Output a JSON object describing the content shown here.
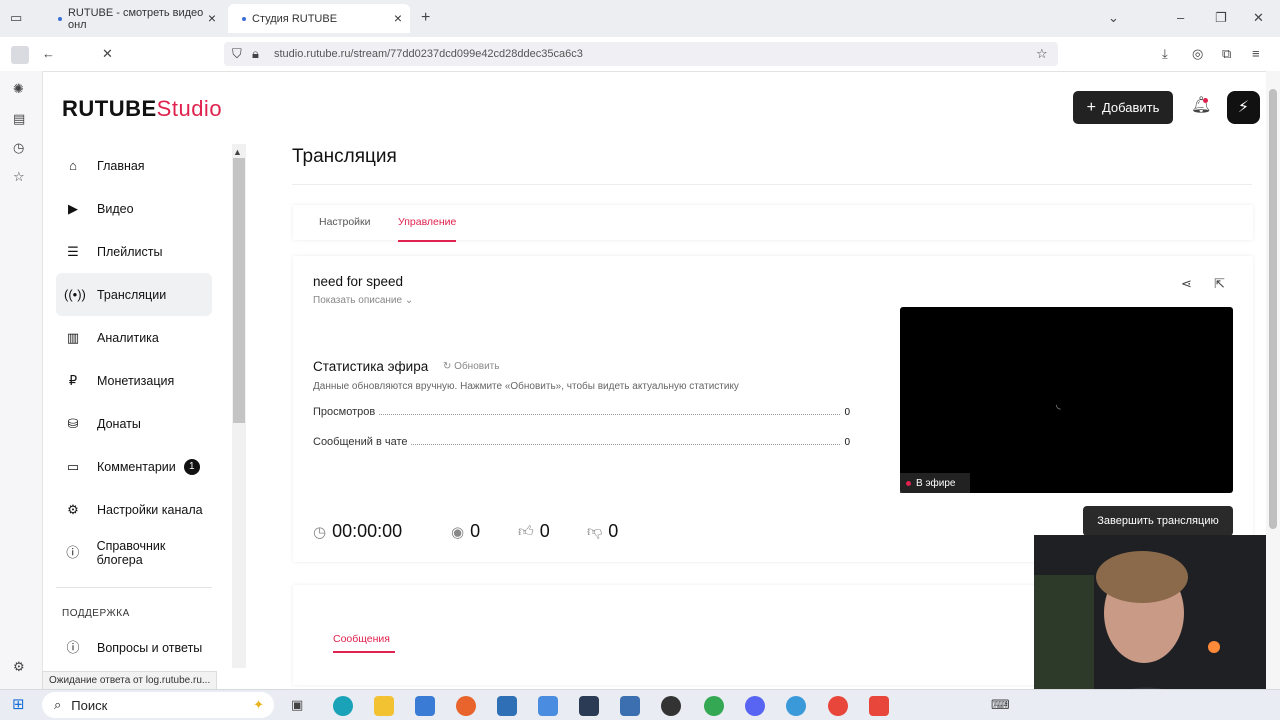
{
  "browser": {
    "tabs": [
      {
        "title": "RUTUBE - смотреть видео онл",
        "active": false
      },
      {
        "title": "Студия RUTUBE",
        "active": true
      }
    ],
    "url": "studio.rutube.ru/stream/77dd0237dcd099e42cd28ddec35ca6c3",
    "status_text": "Ожидание ответа от log.rutube.ru..."
  },
  "header": {
    "logo_main": "RUTUBE",
    "logo_sub": "Studio",
    "add_label": "Добавить"
  },
  "sidebar": {
    "items": [
      {
        "label": "Главная",
        "icon": "home-icon"
      },
      {
        "label": "Видео",
        "icon": "video-icon"
      },
      {
        "label": "Плейлисты",
        "icon": "playlist-icon"
      },
      {
        "label": "Трансляции",
        "icon": "broadcast-icon",
        "active": true
      },
      {
        "label": "Аналитика",
        "icon": "analytics-icon"
      },
      {
        "label": "Монетизация",
        "icon": "ruble-icon"
      },
      {
        "label": "Донаты",
        "icon": "donate-icon"
      },
      {
        "label": "Комментарии",
        "icon": "comment-icon",
        "badge": "1"
      },
      {
        "label": "Настройки канала",
        "icon": "gear-icon"
      },
      {
        "label": "Справочник блогера",
        "icon": "info-icon"
      }
    ],
    "support_heading": "ПОДДЕРЖКА",
    "support_items": [
      {
        "label": "Вопросы и ответы",
        "icon": "question-icon"
      }
    ]
  },
  "main": {
    "title": "Трансляция",
    "tabs": [
      {
        "label": "Настройки",
        "selected": false
      },
      {
        "label": "Управление",
        "selected": true
      }
    ],
    "stream": {
      "name": "need for speed",
      "show_description": "Показать описание",
      "stats_title": "Статистика эфира",
      "refresh_label": "Обновить",
      "stats_note": "Данные обновляются вручную. Нажмите «Обновить», чтобы видеть актуальную статистику",
      "stats": [
        {
          "label": "Просмотров",
          "value": "0"
        },
        {
          "label": "Сообщений в чате",
          "value": "0"
        }
      ],
      "timer": "00:00:00",
      "viewers": "0",
      "likes": "0",
      "dislikes": "0",
      "live_label": "В эфире",
      "end_button": "Завершить трансляцию"
    },
    "messages_tab": "Сообщения"
  },
  "taskbar": {
    "search_label": "Поиск"
  }
}
